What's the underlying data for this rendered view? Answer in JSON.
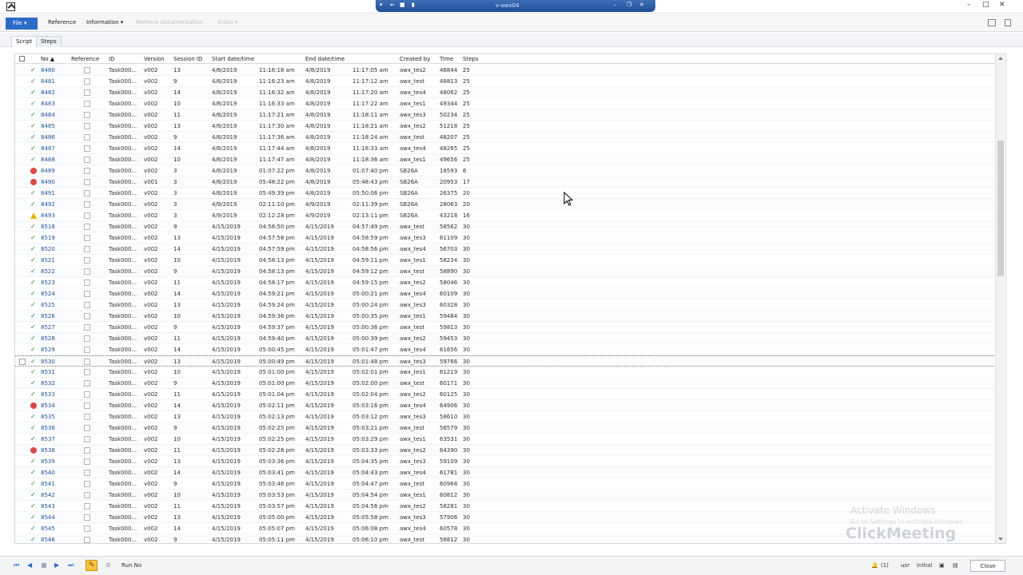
{
  "window": {
    "remote_title": "v-awx04",
    "remote_icons": [
      "pin-icon",
      "back-icon",
      "lock-icon",
      "signal-icon"
    ],
    "window_controls": [
      "minimize-icon",
      "maximize-icon",
      "close-icon"
    ]
  },
  "menu": {
    "file": "File",
    "items": [
      {
        "label": "Reference",
        "disabled": false
      },
      {
        "label": "Information",
        "disabled": false
      },
      {
        "label": "Remove documentation",
        "disabled": true
      },
      {
        "label": "Video",
        "disabled": true
      }
    ]
  },
  "tabs": [
    {
      "label": "Script",
      "active": true
    },
    {
      "label": "Steps",
      "active": false
    }
  ],
  "grid": {
    "headers": [
      "No",
      "Reference",
      "ID",
      "Version",
      "Session ID",
      "Start date/time",
      "End date/time",
      "Created by",
      "Time",
      "Steps"
    ],
    "rows": [
      {
        "status": "ok",
        "no": "8480",
        "id": "Task000...",
        "version": "v002",
        "session": "13",
        "start_date": "4/8/2019",
        "start_time": "11:16:18 am",
        "end_date": "4/8/2019",
        "end_time": "11:17:05 am",
        "created_by": "awx_tes2",
        "time": "46844",
        "steps": "25"
      },
      {
        "status": "ok",
        "no": "8481",
        "id": "Task000...",
        "version": "v002",
        "session": "9",
        "start_date": "4/8/2019",
        "start_time": "11:16:23 am",
        "end_date": "4/8/2019",
        "end_time": "11:17:12 am",
        "created_by": "awx_test",
        "time": "48813",
        "steps": "25"
      },
      {
        "status": "ok",
        "no": "8482",
        "id": "Task000...",
        "version": "v002",
        "session": "14",
        "start_date": "4/8/2019",
        "start_time": "11:16:32 am",
        "end_date": "4/8/2019",
        "end_time": "11:17:20 am",
        "created_by": "awx_tes4",
        "time": "48062",
        "steps": "25"
      },
      {
        "status": "ok",
        "no": "8483",
        "id": "Task000...",
        "version": "v002",
        "session": "10",
        "start_date": "4/8/2019",
        "start_time": "11:16:33 am",
        "end_date": "4/8/2019",
        "end_time": "11:17:22 am",
        "created_by": "awx_tes1",
        "time": "49344",
        "steps": "25"
      },
      {
        "status": "ok",
        "no": "8484",
        "id": "Task000...",
        "version": "v002",
        "session": "11",
        "start_date": "4/8/2019",
        "start_time": "11:17:21 am",
        "end_date": "4/8/2019",
        "end_time": "11:18:11 am",
        "created_by": "awx_tes3",
        "time": "50234",
        "steps": "25"
      },
      {
        "status": "ok",
        "no": "8485",
        "id": "Task000...",
        "version": "v002",
        "session": "13",
        "start_date": "4/8/2019",
        "start_time": "11:17:30 am",
        "end_date": "4/8/2019",
        "end_time": "11:18:21 am",
        "created_by": "awx_tes2",
        "time": "51218",
        "steps": "25"
      },
      {
        "status": "ok",
        "no": "8486",
        "id": "Task000...",
        "version": "v002",
        "session": "9",
        "start_date": "4/8/2019",
        "start_time": "11:17:36 am",
        "end_date": "4/8/2019",
        "end_time": "11:18:24 am",
        "created_by": "awx_test",
        "time": "48207",
        "steps": "25"
      },
      {
        "status": "ok",
        "no": "8487",
        "id": "Task000...",
        "version": "v002",
        "session": "14",
        "start_date": "4/8/2019",
        "start_time": "11:17:44 am",
        "end_date": "4/8/2019",
        "end_time": "11:18:33 am",
        "created_by": "awx_tes4",
        "time": "48265",
        "steps": "25"
      },
      {
        "status": "ok",
        "no": "8488",
        "id": "Task000...",
        "version": "v002",
        "session": "10",
        "start_date": "4/8/2019",
        "start_time": "11:17:47 am",
        "end_date": "4/8/2019",
        "end_time": "11:18:36 am",
        "created_by": "awx_tes1",
        "time": "49656",
        "steps": "25"
      },
      {
        "status": "error",
        "no": "8489",
        "id": "Task000...",
        "version": "v002",
        "session": "3",
        "start_date": "4/8/2019",
        "start_time": "01:07:22 pm",
        "end_date": "4/8/2019",
        "end_time": "01:07:40 pm",
        "created_by": "SB26A",
        "time": "18593",
        "steps": "6"
      },
      {
        "status": "error",
        "no": "8490",
        "id": "Task000...",
        "version": "v001",
        "session": "3",
        "start_date": "4/8/2019",
        "start_time": "05:48:22 pm",
        "end_date": "4/8/2019",
        "end_time": "05:48:43 pm",
        "created_by": "SB26A",
        "time": "20953",
        "steps": "17"
      },
      {
        "status": "ok",
        "no": "8491",
        "id": "Task000...",
        "version": "v002",
        "session": "3",
        "start_date": "4/8/2019",
        "start_time": "05:49:39 pm",
        "end_date": "4/8/2019",
        "end_time": "05:50:06 pm",
        "created_by": "SB26A",
        "time": "26375",
        "steps": "20"
      },
      {
        "status": "ok",
        "no": "8492",
        "id": "Task000...",
        "version": "v002",
        "session": "3",
        "start_date": "4/9/2019",
        "start_time": "02:11:10 pm",
        "end_date": "4/9/2019",
        "end_time": "02:11:39 pm",
        "created_by": "SB26A",
        "time": "28063",
        "steps": "20"
      },
      {
        "status": "warn",
        "no": "8493",
        "id": "Task000...",
        "version": "v002",
        "session": "3",
        "start_date": "4/9/2019",
        "start_time": "02:12:28 pm",
        "end_date": "4/9/2019",
        "end_time": "02:13:11 pm",
        "created_by": "SB26A",
        "time": "43218",
        "steps": "16"
      },
      {
        "status": "ok",
        "no": "8518",
        "id": "Task000...",
        "version": "v002",
        "session": "9",
        "start_date": "4/15/2019",
        "start_time": "04:56:50 pm",
        "end_date": "4/15/2019",
        "end_time": "04:57:49 pm",
        "created_by": "awx_test",
        "time": "58562",
        "steps": "30"
      },
      {
        "status": "ok",
        "no": "8519",
        "id": "Task000...",
        "version": "v002",
        "session": "13",
        "start_date": "4/15/2019",
        "start_time": "04:57:58 pm",
        "end_date": "4/15/2019",
        "end_time": "04:58:59 pm",
        "created_by": "awx_tes3",
        "time": "61109",
        "steps": "30"
      },
      {
        "status": "ok",
        "no": "8520",
        "id": "Task000...",
        "version": "v002",
        "session": "14",
        "start_date": "4/15/2019",
        "start_time": "04:57:59 pm",
        "end_date": "4/15/2019",
        "end_time": "04:58:56 pm",
        "created_by": "awx_tes4",
        "time": "56703",
        "steps": "30"
      },
      {
        "status": "ok",
        "no": "8521",
        "id": "Task000...",
        "version": "v002",
        "session": "10",
        "start_date": "4/15/2019",
        "start_time": "04:58:13 pm",
        "end_date": "4/15/2019",
        "end_time": "04:59:11 pm",
        "created_by": "awx_tes1",
        "time": "58234",
        "steps": "30"
      },
      {
        "status": "ok",
        "no": "8522",
        "id": "Task000...",
        "version": "v002",
        "session": "9",
        "start_date": "4/15/2019",
        "start_time": "04:58:13 pm",
        "end_date": "4/15/2019",
        "end_time": "04:59:12 pm",
        "created_by": "awx_test",
        "time": "58890",
        "steps": "30"
      },
      {
        "status": "ok",
        "no": "8523",
        "id": "Task000...",
        "version": "v002",
        "session": "11",
        "start_date": "4/15/2019",
        "start_time": "04:58:17 pm",
        "end_date": "4/15/2019",
        "end_time": "04:59:15 pm",
        "created_by": "awx_tes2",
        "time": "58046",
        "steps": "30"
      },
      {
        "status": "ok",
        "no": "8524",
        "id": "Task000...",
        "version": "v002",
        "session": "14",
        "start_date": "4/15/2019",
        "start_time": "04:59:21 pm",
        "end_date": "4/15/2019",
        "end_time": "05:00:21 pm",
        "created_by": "awx_tes4",
        "time": "60109",
        "steps": "30"
      },
      {
        "status": "ok",
        "no": "8525",
        "id": "Task000...",
        "version": "v002",
        "session": "13",
        "start_date": "4/15/2019",
        "start_time": "04:59:24 pm",
        "end_date": "4/15/2019",
        "end_time": "05:00:24 pm",
        "created_by": "awx_tes3",
        "time": "60328",
        "steps": "30"
      },
      {
        "status": "ok",
        "no": "8526",
        "id": "Task000...",
        "version": "v002",
        "session": "10",
        "start_date": "4/15/2019",
        "start_time": "04:59:36 pm",
        "end_date": "4/15/2019",
        "end_time": "05:00:35 pm",
        "created_by": "awx_tes1",
        "time": "59484",
        "steps": "30"
      },
      {
        "status": "ok",
        "no": "8527",
        "id": "Task000...",
        "version": "v002",
        "session": "9",
        "start_date": "4/15/2019",
        "start_time": "04:59:37 pm",
        "end_date": "4/15/2019",
        "end_time": "05:00:36 pm",
        "created_by": "awx_test",
        "time": "59813",
        "steps": "30"
      },
      {
        "status": "ok",
        "no": "8528",
        "id": "Task000...",
        "version": "v002",
        "session": "11",
        "start_date": "4/15/2019",
        "start_time": "04:59:40 pm",
        "end_date": "4/15/2019",
        "end_time": "05:00:39 pm",
        "created_by": "awx_tes2",
        "time": "59453",
        "steps": "30"
      },
      {
        "status": "ok",
        "no": "8529",
        "id": "Task000...",
        "version": "v002",
        "session": "14",
        "start_date": "4/15/2019",
        "start_time": "05:00:45 pm",
        "end_date": "4/15/2019",
        "end_time": "05:01:47 pm",
        "created_by": "awx_tes4",
        "time": "61656",
        "steps": "30"
      },
      {
        "status": "ok",
        "focused": true,
        "no": "8530",
        "id": "Task000...",
        "version": "v002",
        "session": "13",
        "start_date": "4/15/2019",
        "start_time": "05:00:49 pm",
        "end_date": "4/15/2019",
        "end_time": "05:01:48 pm",
        "created_by": "awx_tes3",
        "time": "59766",
        "steps": "30"
      },
      {
        "status": "ok",
        "no": "8531",
        "id": "Task000...",
        "version": "v002",
        "session": "10",
        "start_date": "4/15/2019",
        "start_time": "05:01:00 pm",
        "end_date": "4/15/2019",
        "end_time": "05:02:01 pm",
        "created_by": "awx_tes1",
        "time": "61219",
        "steps": "30"
      },
      {
        "status": "ok",
        "no": "8532",
        "id": "Task000...",
        "version": "v002",
        "session": "9",
        "start_date": "4/15/2019",
        "start_time": "05:01:00 pm",
        "end_date": "4/15/2019",
        "end_time": "05:02:00 pm",
        "created_by": "awx_test",
        "time": "60171",
        "steps": "30"
      },
      {
        "status": "ok",
        "no": "8533",
        "id": "Task000...",
        "version": "v002",
        "session": "11",
        "start_date": "4/15/2019",
        "start_time": "05:01:04 pm",
        "end_date": "4/15/2019",
        "end_time": "05:02:04 pm",
        "created_by": "awx_tes2",
        "time": "60125",
        "steps": "30"
      },
      {
        "status": "error",
        "no": "8534",
        "id": "Task000...",
        "version": "v002",
        "session": "14",
        "start_date": "4/15/2019",
        "start_time": "05:02:11 pm",
        "end_date": "4/15/2019",
        "end_time": "05:03:16 pm",
        "created_by": "awx_tes4",
        "time": "64906",
        "steps": "30"
      },
      {
        "status": "ok",
        "no": "8535",
        "id": "Task000...",
        "version": "v002",
        "session": "13",
        "start_date": "4/15/2019",
        "start_time": "05:02:13 pm",
        "end_date": "4/15/2019",
        "end_time": "05:03:12 pm",
        "created_by": "awx_tes3",
        "time": "58610",
        "steps": "30"
      },
      {
        "status": "ok",
        "no": "8536",
        "id": "Task000...",
        "version": "v002",
        "session": "9",
        "start_date": "4/15/2019",
        "start_time": "05:02:25 pm",
        "end_date": "4/15/2019",
        "end_time": "05:03:21 pm",
        "created_by": "awx_test",
        "time": "56579",
        "steps": "30"
      },
      {
        "status": "ok",
        "no": "8537",
        "id": "Task000...",
        "version": "v002",
        "session": "10",
        "start_date": "4/15/2019",
        "start_time": "05:02:25 pm",
        "end_date": "4/15/2019",
        "end_time": "05:03:29 pm",
        "created_by": "awx_tes1",
        "time": "63531",
        "steps": "30"
      },
      {
        "status": "error",
        "no": "8538",
        "id": "Task000...",
        "version": "v002",
        "session": "11",
        "start_date": "4/15/2019",
        "start_time": "05:02:28 pm",
        "end_date": "4/15/2019",
        "end_time": "05:03:33 pm",
        "created_by": "awx_tes2",
        "time": "64390",
        "steps": "30"
      },
      {
        "status": "ok",
        "no": "8539",
        "id": "Task000...",
        "version": "v002",
        "session": "13",
        "start_date": "4/15/2019",
        "start_time": "05:03:36 pm",
        "end_date": "4/15/2019",
        "end_time": "05:04:35 pm",
        "created_by": "awx_tes3",
        "time": "59109",
        "steps": "30"
      },
      {
        "status": "ok",
        "no": "8540",
        "id": "Task000...",
        "version": "v002",
        "session": "14",
        "start_date": "4/15/2019",
        "start_time": "05:03:41 pm",
        "end_date": "4/15/2019",
        "end_time": "05:04:43 pm",
        "created_by": "awx_tes4",
        "time": "61781",
        "steps": "30"
      },
      {
        "status": "ok",
        "no": "8541",
        "id": "Task000...",
        "version": "v002",
        "session": "9",
        "start_date": "4/15/2019",
        "start_time": "05:03:46 pm",
        "end_date": "4/15/2019",
        "end_time": "05:04:47 pm",
        "created_by": "awx_test",
        "time": "60968",
        "steps": "30"
      },
      {
        "status": "ok",
        "no": "8542",
        "id": "Task000...",
        "version": "v002",
        "session": "10",
        "start_date": "4/15/2019",
        "start_time": "05:03:53 pm",
        "end_date": "4/15/2019",
        "end_time": "05:04:54 pm",
        "created_by": "awx_tes1",
        "time": "60812",
        "steps": "30"
      },
      {
        "status": "ok",
        "no": "8543",
        "id": "Task000...",
        "version": "v002",
        "session": "11",
        "start_date": "4/15/2019",
        "start_time": "05:03:57 pm",
        "end_date": "4/15/2019",
        "end_time": "05:04:56 pm",
        "created_by": "awx_tes2",
        "time": "58281",
        "steps": "30"
      },
      {
        "status": "ok",
        "no": "8544",
        "id": "Task000...",
        "version": "v002",
        "session": "13",
        "start_date": "4/15/2019",
        "start_time": "05:05:00 pm",
        "end_date": "4/15/2019",
        "end_time": "05:05:58 pm",
        "created_by": "awx_tes3",
        "time": "57906",
        "steps": "30"
      },
      {
        "status": "ok",
        "no": "8545",
        "id": "Task000...",
        "version": "v002",
        "session": "14",
        "start_date": "4/15/2019",
        "start_time": "05:05:07 pm",
        "end_date": "4/15/2019",
        "end_time": "05:06:08 pm",
        "created_by": "awx_tes4",
        "time": "60578",
        "steps": "30"
      },
      {
        "status": "ok",
        "no": "8546",
        "id": "Task000...",
        "version": "v002",
        "session": "9",
        "start_date": "4/15/2019",
        "start_time": "05:05:11 pm",
        "end_date": "4/15/2019",
        "end_time": "05:06:10 pm",
        "created_by": "awx_test",
        "time": "58812",
        "steps": "30"
      }
    ]
  },
  "footer": {
    "run_no_label": "Run No",
    "status_items": [
      "(1)",
      "usr",
      "initial"
    ],
    "close_label": "Close"
  },
  "watermark": {
    "activate_title": "Activate Windows",
    "activate_sub": "Go to Settings to activate Windows.",
    "brand": "ClickMeeting"
  },
  "colors": {
    "accent": "#2d6bc9",
    "ok": "#1f7d28",
    "error": "#d94848",
    "warn": "#e6b400"
  }
}
